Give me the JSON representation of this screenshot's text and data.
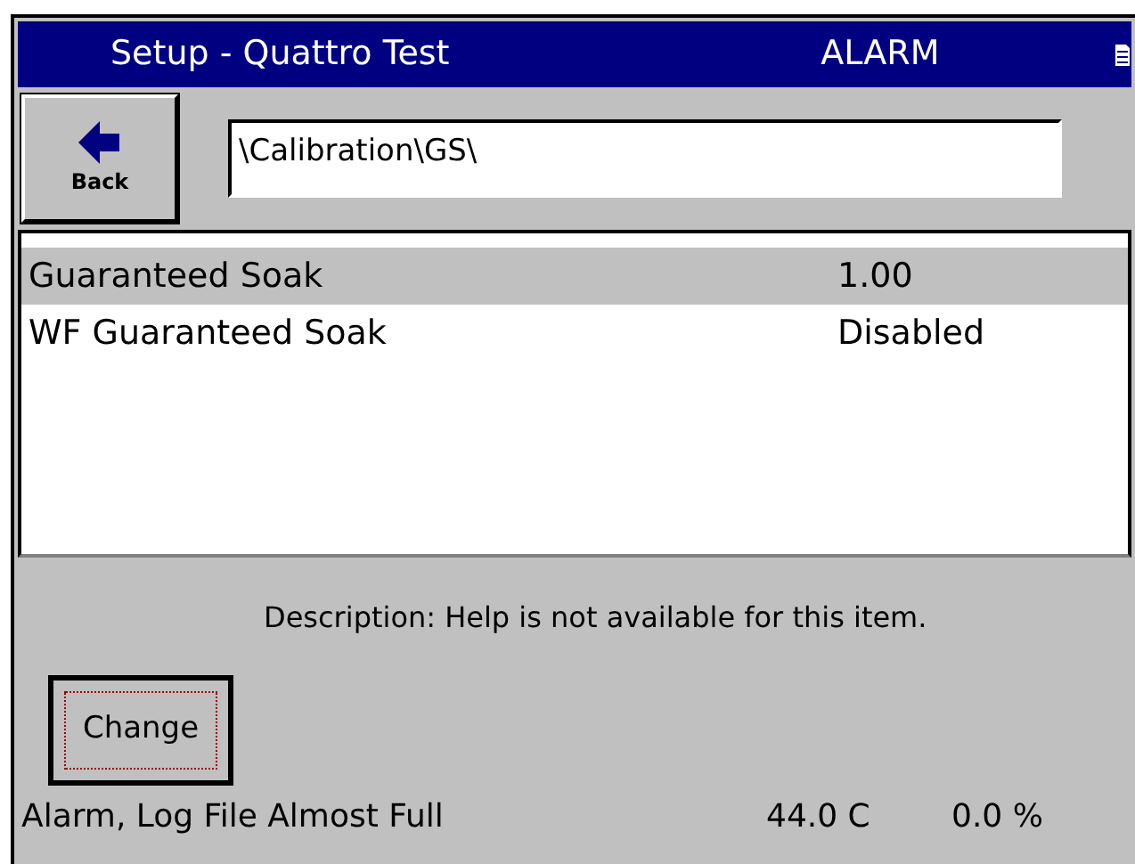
{
  "window": {
    "title": "Setup - Quattro Test",
    "alarm": "ALARM"
  },
  "toolbar": {
    "back_button": "Back",
    "path": "\\Calibration\\GS\\"
  },
  "list": [
    {
      "name": "Guaranteed Soak",
      "value": "1.00",
      "selected": true
    },
    {
      "name": "WF Guaranteed Soak",
      "value": "Disabled",
      "selected": false
    }
  ],
  "description": "Description:  Help is not available for this item.",
  "change_button": "Change",
  "status_bar": {
    "message": "Alarm, Log File Almost Full",
    "temperature": "44.0 C",
    "percent": "0.0 %"
  }
}
